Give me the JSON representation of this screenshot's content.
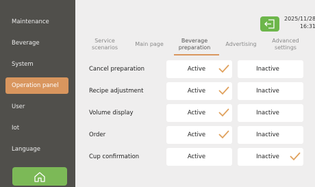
{
  "sidebar": {
    "items": [
      {
        "label": "Maintenance",
        "active": false
      },
      {
        "label": "Beverage",
        "active": false
      },
      {
        "label": "System",
        "active": false
      },
      {
        "label": "Operation panel",
        "active": true
      },
      {
        "label": "User",
        "active": false
      },
      {
        "label": "Iot",
        "active": false
      },
      {
        "label": "Language",
        "active": false
      }
    ],
    "home_icon": "home-icon"
  },
  "header": {
    "exit_icon": "exit-icon",
    "date": "2025/11/28",
    "time": "16:31"
  },
  "tabs": [
    {
      "line1": "Service",
      "line2": "scenarios",
      "active": false
    },
    {
      "line1": "Main page",
      "line2": "",
      "active": false
    },
    {
      "line1": "Beverage",
      "line2": "preparation",
      "active": true
    },
    {
      "line1": "Advertising",
      "line2": "",
      "active": false
    },
    {
      "line1": "Advanced",
      "line2": "settings",
      "active": false
    }
  ],
  "options": {
    "active_label": "Active",
    "inactive_label": "Inactive"
  },
  "settings": [
    {
      "label": "Cancel preparation",
      "selected": "Active"
    },
    {
      "label": "Recipe adjustment",
      "selected": "Active"
    },
    {
      "label": "Volume display",
      "selected": "Active"
    },
    {
      "label": "Order",
      "selected": "Active"
    },
    {
      "label": "Cup confirmation",
      "selected": "Inactive"
    }
  ],
  "colors": {
    "accent": "#d9965e",
    "green": "#6db64b",
    "sidebar": "#504f4b",
    "check": "#e0a15d"
  }
}
